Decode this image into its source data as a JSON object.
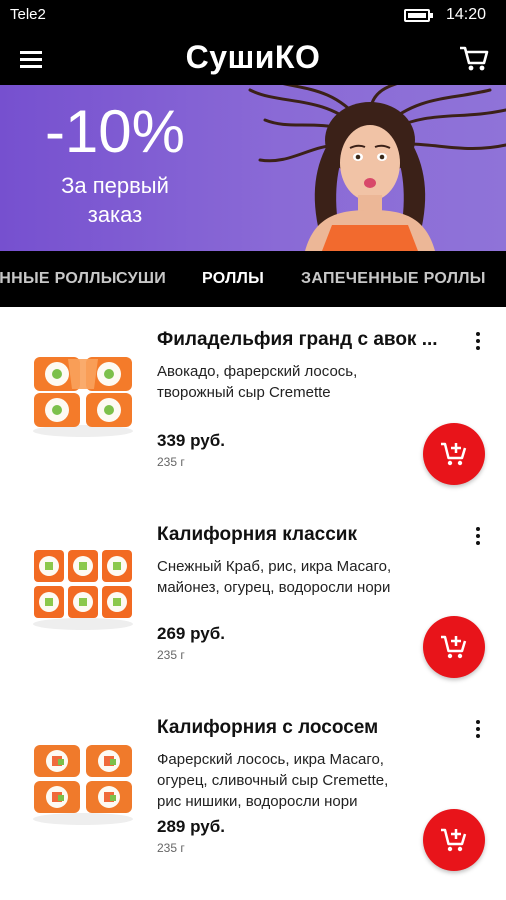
{
  "status_bar": {
    "carrier": "Tele2",
    "time": "14:20"
  },
  "app_bar": {
    "title": "СушиКО",
    "menu_icon": "hamburger-menu-icon",
    "cart_icon": "cart-icon"
  },
  "banner": {
    "discount": "-10%",
    "subtitle_line1": "За первый",
    "subtitle_line2": "заказ"
  },
  "tabs": [
    {
      "label": "ЗАПЕЧЕННЫЕ РОЛЛЫ",
      "active": false
    },
    {
      "label": "СУШИ",
      "active": false
    },
    {
      "label": "РОЛЛЫ",
      "active": true
    },
    {
      "label": "ЗАПЕЧЕННЫЕ РОЛЛЫ",
      "active": false
    }
  ],
  "products": [
    {
      "name": "Филадельфия гранд с авок ...",
      "desc_line1": "Авокадо, фарерский лосось,",
      "desc_line2": "творожный сыр Cremette",
      "desc_line3": "",
      "price": "339 руб.",
      "weight": "235 г"
    },
    {
      "name": "Калифорния классик",
      "desc_line1": "Снежный Краб, рис, икра Масаго,",
      "desc_line2": "майонез, огурец, водоросли нори",
      "desc_line3": "",
      "price": "269 руб.",
      "weight": "235 г"
    },
    {
      "name": "Калифорния с лососем",
      "desc_line1": "Фарерский лосось, икра Масаго,",
      "desc_line2": "огурец, сливочный сыр Cremette,",
      "desc_line3": "рис нишики, водоросли нори",
      "price": "289 руб.",
      "weight": "235 г"
    }
  ],
  "colors": {
    "accent_red": "#e8141a",
    "banner_purple": "#7d5ad2",
    "bar_black": "#000000"
  },
  "icons": {
    "more": "more-vert-icon",
    "add": "add-to-cart-icon"
  }
}
